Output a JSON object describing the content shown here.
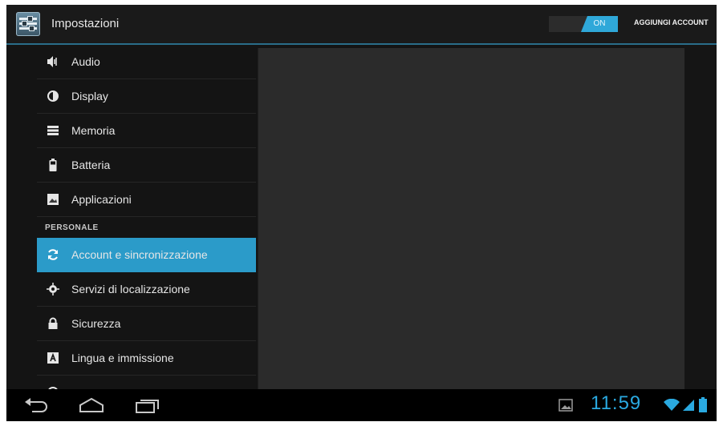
{
  "header": {
    "title": "Impostazioni",
    "toggle_label": "ON",
    "add_account_label": "AGGIUNGI ACCOUNT"
  },
  "sidebar": {
    "items_top": [
      {
        "label": "Audio",
        "icon": "speaker-icon"
      },
      {
        "label": "Display",
        "icon": "brightness-icon"
      },
      {
        "label": "Memoria",
        "icon": "storage-icon"
      },
      {
        "label": "Batteria",
        "icon": "battery-icon"
      },
      {
        "label": "Applicazioni",
        "icon": "apps-icon"
      }
    ],
    "section_label": "PERSONALE",
    "items_personal": [
      {
        "label": "Account e sincronizzazione",
        "icon": "sync-icon",
        "selected": true
      },
      {
        "label": "Servizi di localizzazione",
        "icon": "location-icon"
      },
      {
        "label": "Sicurezza",
        "icon": "lock-icon"
      },
      {
        "label": "Lingua e immissione",
        "icon": "keyboard-letter-icon"
      }
    ]
  },
  "status": {
    "time": "11:59",
    "icons": [
      "gallery-icon",
      "wifi-icon",
      "signal-icon",
      "battery-icon"
    ]
  },
  "navbar": {
    "icons": [
      "back-icon",
      "home-icon",
      "recent-apps-icon"
    ]
  },
  "colors": {
    "accent": "#2b9bc9",
    "clock": "#2aa9e0"
  }
}
